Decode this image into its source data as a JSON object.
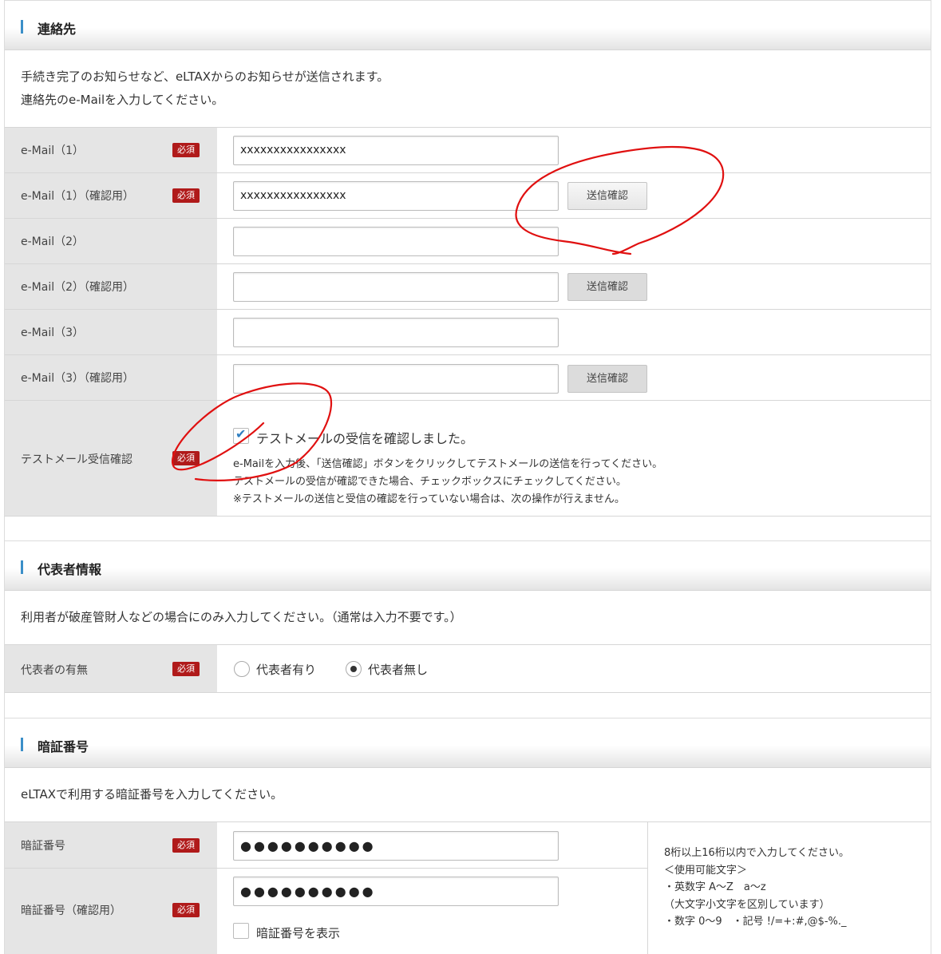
{
  "contact": {
    "title": "連絡先",
    "desc_line1": "手続き完了のお知らせなど、eLTAXからのお知らせが送信されます。",
    "desc_line2": "連絡先のe-Mailを入力してください。",
    "required_label": "必須",
    "rows": [
      {
        "label": "e-Mail（1）",
        "value": "xxxxxxxxxxxxxxxx"
      },
      {
        "label": "e-Mail（1）（確認用）",
        "value": "xxxxxxxxxxxxxxxx",
        "button": "送信確認"
      },
      {
        "label": "e-Mail（2）",
        "value": ""
      },
      {
        "label": "e-Mail（2）（確認用）",
        "value": "",
        "button": "送信確認"
      },
      {
        "label": "e-Mail（3）",
        "value": ""
      },
      {
        "label": "e-Mail（3）（確認用）",
        "value": "",
        "button": "送信確認"
      }
    ],
    "test_mail": {
      "label": "テストメール受信確認",
      "checkbox_label": "テストメールの受信を確認しました。",
      "checked": true,
      "note1": "e-Mailを入力後、「送信確認」ボタンをクリックしてテストメールの送信を行ってください。",
      "note2": "テストメールの受信が確認できた場合、チェックボックスにチェックしてください。",
      "note3": "※テストメールの送信と受信の確認を行っていない場合は、次の操作が行えません。"
    }
  },
  "representative": {
    "title": "代表者情報",
    "desc": "利用者が破産管財人などの場合にのみ入力してください。（通常は入力不要です。）",
    "label": "代表者の有無",
    "option_yes": "代表者有り",
    "option_no": "代表者無し",
    "selected": "代表者無し"
  },
  "pin": {
    "title": "暗証番号",
    "desc": "eLTAXで利用する暗証番号を入力してください。",
    "label": "暗証番号",
    "label_confirm": "暗証番号（確認用）",
    "value_masked": "●●●●●●●●●●",
    "value_confirm_masked": "●●●●●●●●●●",
    "show_label": "暗証番号を表示",
    "hint1": "8桁以上16桁以内で入力してください。",
    "hint2": "＜使用可能文字＞",
    "hint3": "・英数字 A～Z　a～z",
    "hint4": "（大文字小文字を区別しています）",
    "hint5": "・数字 0～9　・記号 !/=+:#,@$-%._"
  },
  "colors": {
    "accent_bar": "#3b8fc8",
    "required_badge": "#b01a1a",
    "annotation": "#e01010",
    "checkmark": "#2f7fc1"
  }
}
